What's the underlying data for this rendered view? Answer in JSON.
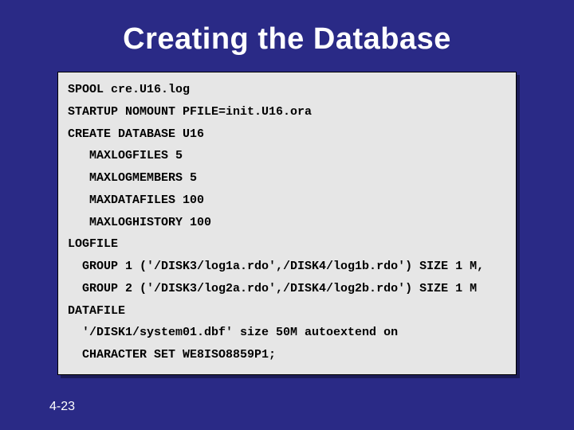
{
  "title": "Creating the Database",
  "code": {
    "l1": "SPOOL cre.U16.log",
    "l2": "STARTUP NOMOUNT PFILE=init.U16.ora",
    "l3": "CREATE DATABASE U16",
    "l4": "   MAXLOGFILES 5",
    "l5": "   MAXLOGMEMBERS 5",
    "l6": "   MAXDATAFILES 100",
    "l7": "   MAXLOGHISTORY 100",
    "l8": "LOGFILE",
    "l9": "  GROUP 1 ('/DISK3/log1a.rdo',/DISK4/log1b.rdo') SIZE 1 M,",
    "l10": "  GROUP 2 ('/DISK3/log2a.rdo',/DISK4/log2b.rdo') SIZE 1 M",
    "l11": "DATAFILE",
    "l12": "  '/DISK1/system01.dbf' size 50M autoextend on",
    "l13": "  CHARACTER SET WE8ISO8859P1;"
  },
  "page_number": "4-23"
}
